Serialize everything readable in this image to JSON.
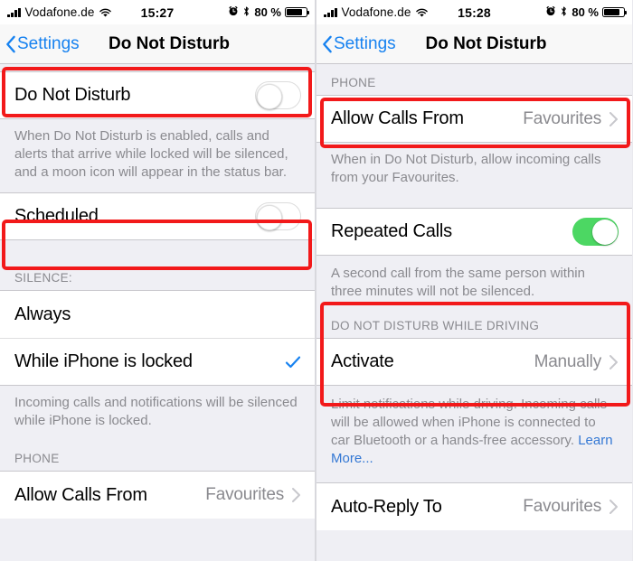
{
  "left": {
    "status_bar": {
      "carrier": "Vodafone.de",
      "time": "15:27",
      "battery_text": "80 %",
      "signal_icon": "signal-bars-icon",
      "wifi_icon": "wifi-icon",
      "alarm_icon": "alarm-clock-icon",
      "bluetooth_icon": "bluetooth-icon",
      "battery_icon": "battery-icon"
    },
    "nav": {
      "back_label": "Settings",
      "title": "Do Not Disturb",
      "back_icon": "chevron-left-icon"
    },
    "rows": {
      "dnd_label": "Do Not Disturb",
      "dnd_state": "off",
      "dnd_note": "When Do Not Disturb is enabled, calls and alerts that arrive while locked will be silenced, and a moon icon will appear in the status bar.",
      "scheduled_label": "Scheduled",
      "scheduled_state": "off",
      "silence_header": "SILENCE:",
      "always_label": "Always",
      "while_locked_label": "While iPhone is locked",
      "while_locked_checked": true,
      "silence_note": "Incoming calls and notifications will be silenced while iPhone is locked.",
      "phone_header": "PHONE",
      "allow_calls_label": "Allow Calls From",
      "allow_calls_value": "Favourites"
    }
  },
  "right": {
    "status_bar": {
      "carrier": "Vodafone.de",
      "time": "15:28",
      "battery_text": "80 %",
      "signal_icon": "signal-bars-icon",
      "wifi_icon": "wifi-icon",
      "alarm_icon": "alarm-clock-icon",
      "bluetooth_icon": "bluetooth-icon",
      "battery_icon": "battery-icon"
    },
    "nav": {
      "back_label": "Settings",
      "title": "Do Not Disturb",
      "back_icon": "chevron-left-icon"
    },
    "rows": {
      "phone_header": "PHONE",
      "allow_calls_label": "Allow Calls From",
      "allow_calls_value": "Favourites",
      "allow_calls_note": "When in Do Not Disturb, allow incoming calls from your Favourites.",
      "repeated_calls_label": "Repeated Calls",
      "repeated_calls_state": "on",
      "repeated_calls_note": "A second call from the same person within three minutes will not be silenced.",
      "driving_header": "DO NOT DISTURB WHILE DRIVING",
      "activate_label": "Activate",
      "activate_value": "Manually",
      "driving_note": "Limit notifications while driving. Incoming calls will be allowed when iPhone is connected to car Bluetooth or a hands-free accessory. ",
      "driving_note_link": "Learn More...",
      "auto_reply_label": "Auto-Reply To",
      "auto_reply_value": "Favourites"
    }
  },
  "colors": {
    "highlight": "#f2191a",
    "tint_blue": "#1782f0",
    "toggle_on_green": "#4cd763",
    "link_blue": "#3478d4",
    "secondary_text": "#8a8a8f"
  }
}
